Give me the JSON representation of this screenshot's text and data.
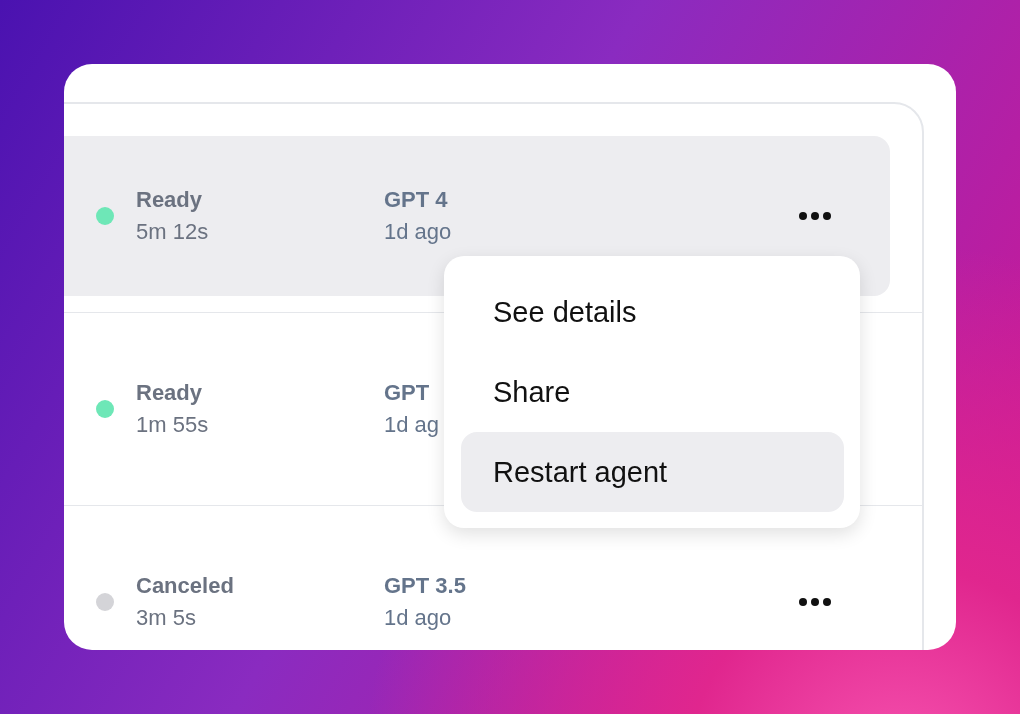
{
  "rows": [
    {
      "status": "Ready",
      "color": "#6ee7b7",
      "duration": "5m 12s",
      "model": "GPT 4",
      "age": "1d ago",
      "selected": true,
      "more_button": true
    },
    {
      "status": "Ready",
      "color": "#6ee7b7",
      "duration": "1m 55s",
      "model": "GPT",
      "age": "1d ag",
      "selected": false
    },
    {
      "status": "Canceled",
      "color": "#d4d4d8",
      "duration": "3m 5s",
      "model": "GPT 3.5",
      "age": "1d ago",
      "selected": false,
      "more_button": true
    }
  ],
  "menu": {
    "items": [
      {
        "label": "See details",
        "selected": false
      },
      {
        "label": "Share",
        "selected": false
      },
      {
        "label": "Restart agent",
        "selected": true
      }
    ]
  }
}
